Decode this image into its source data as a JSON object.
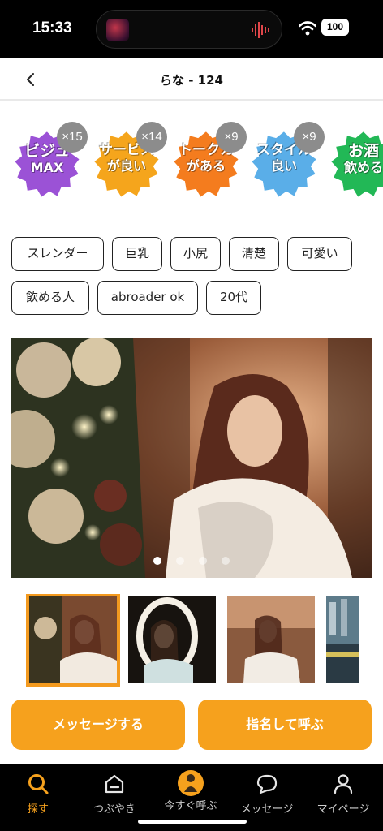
{
  "status_bar": {
    "time": "15:33",
    "battery": "100"
  },
  "header": {
    "title": "らな - 124"
  },
  "badges": [
    {
      "line1": "ビジュ",
      "line2": "MAX",
      "count": "×15",
      "color": "#9b52d6"
    },
    {
      "line1": "サービス",
      "line2": "が良い",
      "count": "×14",
      "color": "#f5a51c"
    },
    {
      "line1": "トークカ",
      "line2": "がある",
      "count": "×9",
      "color": "#f47c1e"
    },
    {
      "line1": "スタイル",
      "line2": "良い",
      "count": "×9",
      "color": "#5aaee8"
    },
    {
      "line1": "お酒",
      "line2": "飲める",
      "count": "",
      "color": "#22b856"
    }
  ],
  "tags": [
    "スレンダー",
    "巨乳",
    "小尻",
    "清楚",
    "可愛い",
    "飲める人",
    "abroader ok",
    "20代"
  ],
  "gallery": {
    "photo_count": 4,
    "active_index": 0
  },
  "actions": {
    "message": "メッセージする",
    "nominate": "指名して呼ぶ"
  },
  "tabbar": [
    {
      "label": "探す",
      "icon": "search-icon",
      "active": true
    },
    {
      "label": "つぶやき",
      "icon": "home-icon",
      "active": false
    },
    {
      "label": "今すぐ呼ぶ",
      "icon": "call-now-icon",
      "active": false
    },
    {
      "label": "メッセージ",
      "icon": "chat-icon",
      "active": false
    },
    {
      "label": "マイページ",
      "icon": "person-icon",
      "active": false
    }
  ],
  "colors": {
    "accent": "#f6a11d",
    "selected_thumb": "#f39a1f"
  }
}
